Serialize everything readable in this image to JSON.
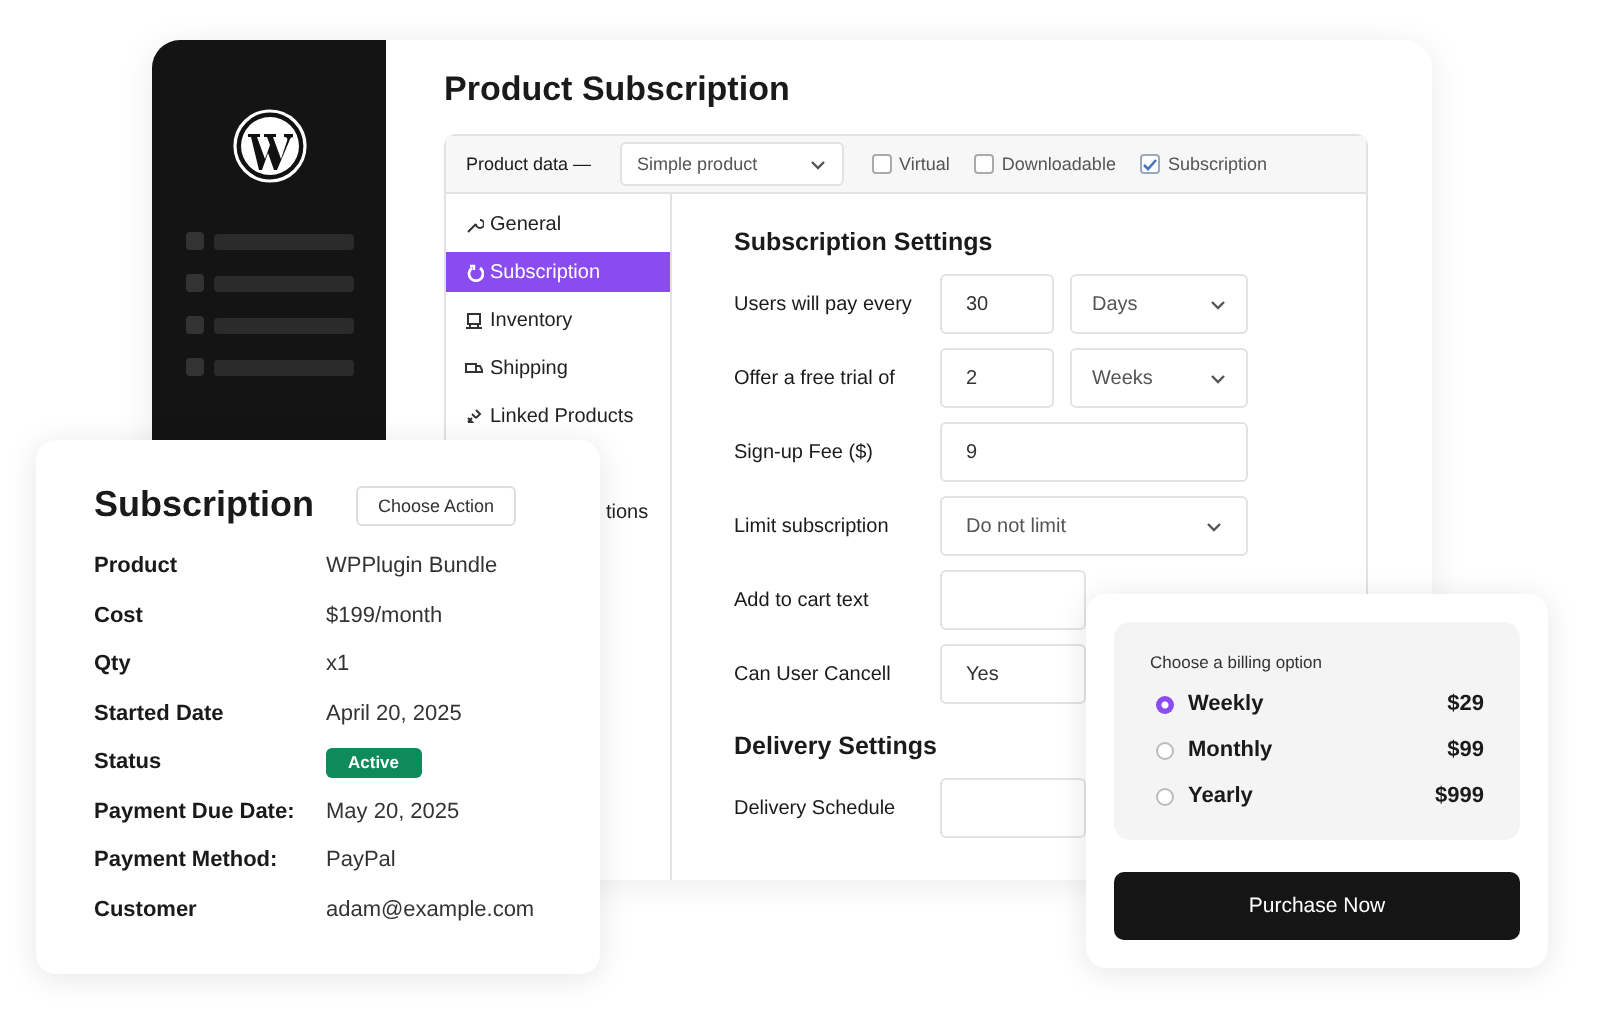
{
  "product_window": {
    "title": "Product Subscription",
    "product_data": {
      "label": "Product data —",
      "type_select": "Simple product",
      "options": [
        {
          "label": "Virtual",
          "checked": false
        },
        {
          "label": "Downloadable",
          "checked": false
        },
        {
          "label": "Subscription",
          "checked": true
        }
      ]
    },
    "tabs": [
      {
        "label": "General",
        "selected": false
      },
      {
        "label": "Subscription",
        "selected": true
      },
      {
        "label": "Inventory",
        "selected": false
      },
      {
        "label": "Shipping",
        "selected": false
      },
      {
        "label": "Linked Products",
        "selected": false
      },
      {
        "label": "tions",
        "selected": false
      }
    ],
    "sections": [
      {
        "heading": "Subscription Settings",
        "rows": [
          {
            "kind": "pair",
            "label": "Users will pay every",
            "value": "30",
            "unit": "Days"
          },
          {
            "kind": "pair",
            "label": "Offer a free trial of",
            "value": "2",
            "unit": "Weeks"
          },
          {
            "kind": "text",
            "label": "Sign-up Fee ($)",
            "value": "9"
          },
          {
            "kind": "select",
            "label": "Limit subscription",
            "value": "Do not limit"
          },
          {
            "kind": "text",
            "label": "Add to cart text"
          },
          {
            "kind": "text",
            "label": "Can User Cancell",
            "value": "Yes"
          }
        ]
      },
      {
        "heading": "Delivery Settings",
        "rows": [
          {
            "kind": "text",
            "label": "Delivery Schedule"
          }
        ]
      }
    ]
  },
  "subscription_card": {
    "title": "Subscription",
    "action_button": "Choose Action",
    "details": [
      {
        "label": "Product",
        "value": "WPPlugin Bundle"
      },
      {
        "label": "Cost",
        "value": "$199/month"
      },
      {
        "label": "Qty",
        "value": "x1"
      },
      {
        "label": "Started Date",
        "value": "April 20, 2025"
      },
      {
        "label": "Status",
        "value": "Active",
        "kind": "badge"
      },
      {
        "label": "Payment Due Date:",
        "value": "May 20, 2025"
      },
      {
        "label": "Payment Method:",
        "value": "PayPal"
      },
      {
        "label": "Customer",
        "value": "adam@example.com"
      }
    ]
  },
  "billing_card": {
    "prompt": "Choose a billing option",
    "options": [
      {
        "label": "Weekly",
        "price": "$29",
        "selected": true
      },
      {
        "label": "Monthly",
        "price": "$99",
        "selected": false
      },
      {
        "label": "Yearly",
        "price": "$999",
        "selected": false
      }
    ],
    "button": "Purchase Now"
  }
}
